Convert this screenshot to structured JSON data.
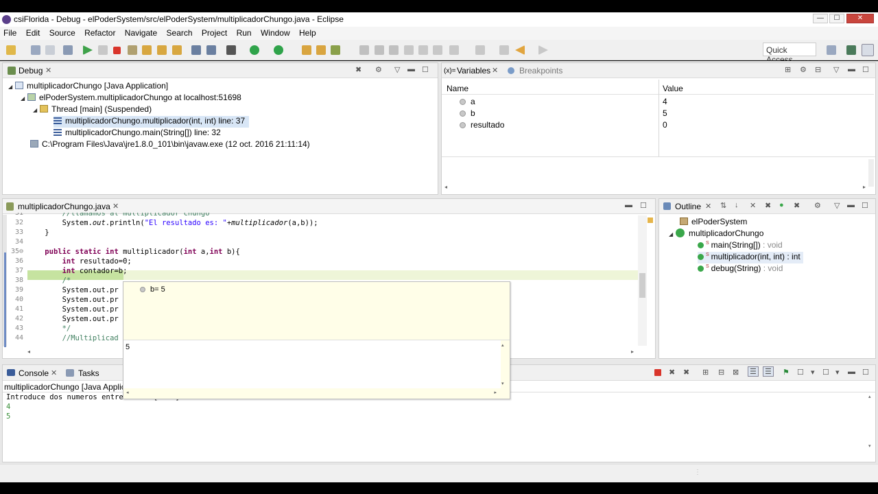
{
  "window": {
    "title": "csiFlorida - Debug - elPoderSystem/src/elPoderSystem/multiplicadorChungo.java - Eclipse",
    "btn_min": "—",
    "btn_max": "☐",
    "btn_close": "✕"
  },
  "menu": [
    "File",
    "Edit",
    "Source",
    "Refactor",
    "Navigate",
    "Search",
    "Project",
    "Run",
    "Window",
    "Help"
  ],
  "toolbar": {
    "quick_access": "Quick Access"
  },
  "debug": {
    "tab": "Debug",
    "rows": [
      "multiplicadorChungo [Java Application]",
      "elPoderSystem.multiplicadorChungo at localhost:51698",
      "Thread [main] (Suspended)",
      "multiplicadorChungo.multiplicador(int, int) line: 37",
      "multiplicadorChungo.main(String[]) line: 32",
      "C:\\Program Files\\Java\\jre1.8.0_101\\bin\\javaw.exe (12 oct. 2016 21:11:14)"
    ]
  },
  "variables": {
    "tab": "Variables",
    "tab_prefix": "(x)=",
    "tab2": "Breakpoints",
    "col_name": "Name",
    "col_value": "Value",
    "rows": [
      {
        "name": "a",
        "value": "4"
      },
      {
        "name": "b",
        "value": "5"
      },
      {
        "name": "resultado",
        "value": "0"
      }
    ]
  },
  "editor": {
    "tab": "multiplicadorChungo.java",
    "lines": [
      {
        "n": "31",
        "html": "        <span class=\"com\">//llamamos al multiplicador chungo</span>"
      },
      {
        "n": "32",
        "html": "        System.<span class=\"it\">out</span>.println(<span class=\"str\">\"El resultado es: \"</span>+<span class=\"it\">multiplicador</span>(a,b));"
      },
      {
        "n": "33",
        "html": "    }"
      },
      {
        "n": "34",
        "html": ""
      },
      {
        "n": "35⊖",
        "html": "    <span class=\"kw\">public static int</span> multiplicador(<span class=\"kw\">int</span> a,<span class=\"kw\">int</span> b){"
      },
      {
        "n": "36",
        "html": "        <span class=\"kw\">int</span> resultado=0;"
      },
      {
        "n": "37",
        "html": "        <span class=\"kw\">int</span> contador=b;"
      },
      {
        "n": "38",
        "html": "        <span class=\"com\">/*</span>"
      },
      {
        "n": "39",
        "html": "        System.out.pr"
      },
      {
        "n": "40",
        "html": "        System.out.pr"
      },
      {
        "n": "41",
        "html": "        System.out.pr"
      },
      {
        "n": "42",
        "html": "        System.out.pr"
      },
      {
        "n": "43",
        "html": "        <span class=\"com\">*/</span>"
      },
      {
        "n": "44",
        "html": "        <span class=\"com\">//Multiplicad</span>"
      }
    ]
  },
  "hover": {
    "var": "b= 5",
    "value": "5"
  },
  "outline": {
    "tab": "Outline",
    "package": "elPoderSystem",
    "class": "multiplicadorChungo",
    "members": [
      {
        "label": "main(String[])",
        "type": " : void",
        "mark": "S"
      },
      {
        "label": "multiplicador(int, int)",
        "type": " : int",
        "mark": "S"
      },
      {
        "label": "debug(String)",
        "type": " : void",
        "mark": "S"
      }
    ]
  },
  "console": {
    "tab": "Console",
    "tab2": "Tasks",
    "header": "multiplicadorChungo [Java Applica",
    "lines": [
      {
        "text": "Introduce dos numeros entre entre [2-10]",
        "color": "#000000"
      },
      {
        "text": "4",
        "color": "#3a8f3a"
      },
      {
        "text": "5",
        "color": "#3a8f3a"
      }
    ]
  }
}
